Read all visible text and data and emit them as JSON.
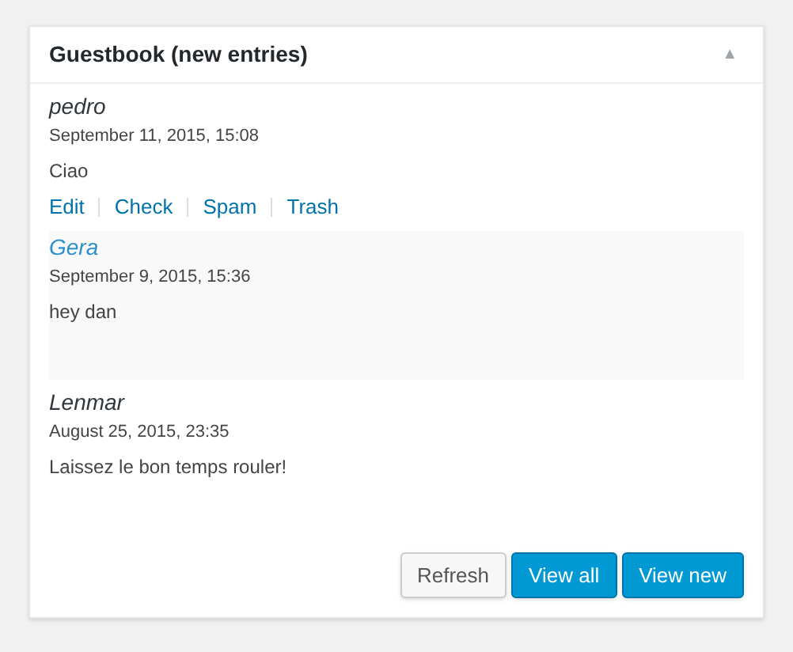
{
  "widget": {
    "title": "Guestbook (new entries)",
    "collapse_toggle": "▲"
  },
  "entries": [
    {
      "author": "pedro",
      "date": "September 11, 2015, 15:08",
      "message": "Ciao",
      "highlighted": false,
      "actions": [
        "Edit",
        "Check",
        "Spam",
        "Trash"
      ]
    },
    {
      "author": "Gera",
      "date": "September 9, 2015, 15:36",
      "message": "hey dan",
      "highlighted": true
    },
    {
      "author": "Lenmar",
      "date": "August 25, 2015, 23:35",
      "message": "Laissez le bon temps rouler!",
      "highlighted": false
    }
  ],
  "buttons": [
    {
      "label": "Refresh",
      "kind": "secondary"
    },
    {
      "label": "View all",
      "kind": "primary"
    },
    {
      "label": "View new",
      "kind": "primary"
    }
  ]
}
